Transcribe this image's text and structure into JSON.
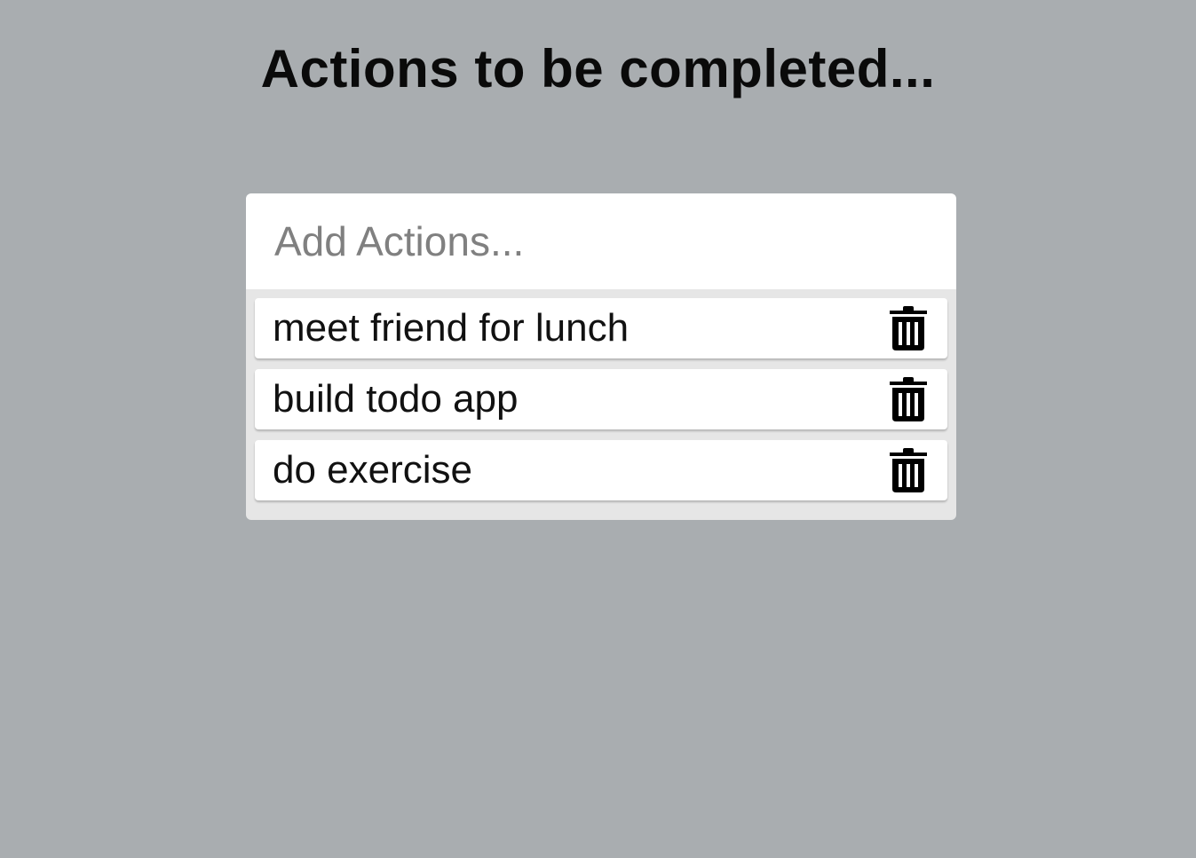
{
  "header": {
    "title": "Actions to be completed..."
  },
  "add_input": {
    "placeholder": "Add Actions...",
    "value": ""
  },
  "todos": [
    {
      "text": "meet friend for lunch",
      "delete_icon": "trash-icon"
    },
    {
      "text": "build todo app",
      "delete_icon": "trash-icon"
    },
    {
      "text": "do exercise",
      "delete_icon": "trash-icon"
    }
  ],
  "colors": {
    "background": "#a9adb0",
    "list_background": "#e6e6e6",
    "card": "#ffffff",
    "text": "#111111",
    "placeholder": "#808080"
  }
}
